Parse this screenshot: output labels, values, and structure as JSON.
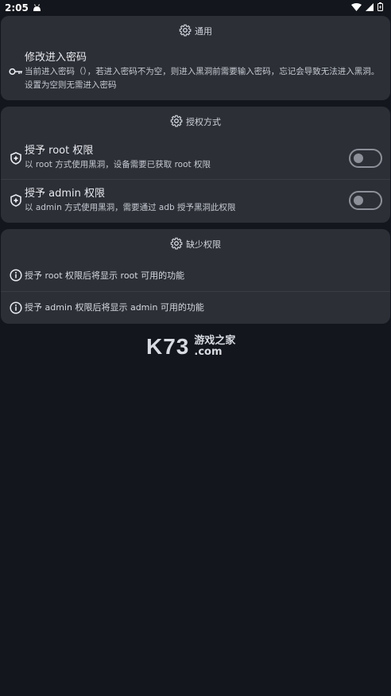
{
  "status_bar": {
    "time": "2:05"
  },
  "sections": {
    "general": {
      "header": "通用",
      "password": {
        "title": "修改进入密码",
        "desc": "当前进入密码（），若进入密码不为空，则进入黑洞前需要输入密码，忘记会导致无法进入黑洞。设置为空则无需进入密码"
      }
    },
    "auth": {
      "header": "授权方式",
      "root": {
        "title": "授予 root 权限",
        "desc": "以 root 方式使用黑洞，设备需要已获取 root 权限",
        "enabled": false
      },
      "admin": {
        "title": "授予 admin 权限",
        "desc": "以 admin 方式使用黑洞，需要通过 adb 授予黑洞此权限",
        "enabled": false
      }
    },
    "missing": {
      "header": "缺少权限",
      "root_info": "授予 root 权限后将显示 root 可用的功能",
      "admin_info": "授予 admin 权限后将显示 admin 可用的功能"
    }
  },
  "watermark": {
    "logo": "K73",
    "cn": "游戏之家",
    "com": ".com"
  },
  "colors": {
    "background": "#13161c",
    "card": "#2c2f35",
    "toggle_off": "#8d9099"
  }
}
